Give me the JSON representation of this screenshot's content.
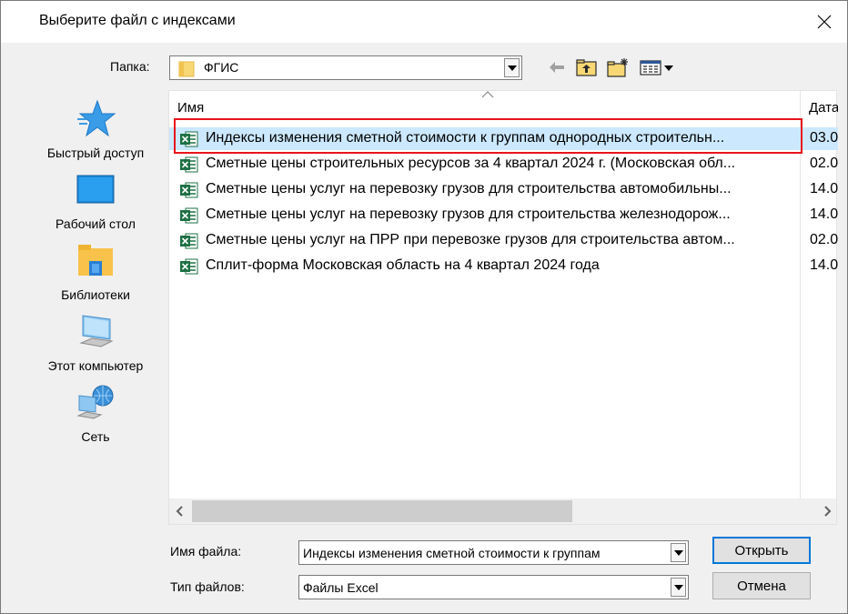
{
  "dialog": {
    "title": "Выберите файл с индексами"
  },
  "folder": {
    "label": "Папка:",
    "current": "ФГИС"
  },
  "places": [
    {
      "label": "Быстрый доступ",
      "icon": "quick-access-star-icon"
    },
    {
      "label": "Рабочий стол",
      "icon": "desktop-icon"
    },
    {
      "label": "Библиотеки",
      "icon": "libraries-icon"
    },
    {
      "label": "Этот компьютер",
      "icon": "this-pc-icon"
    },
    {
      "label": "Сеть",
      "icon": "network-icon"
    }
  ],
  "filelist": {
    "columns": {
      "name": "Имя",
      "date": "Дата"
    },
    "rows": [
      {
        "name": "Индексы изменения сметной стоимости к группам однородных строительн...",
        "date": "03.0",
        "selected": true
      },
      {
        "name": "Сметные цены строительных ресурсов за 4 квартал 2024 г. (Московская обл...",
        "date": "02.0"
      },
      {
        "name": "Сметные цены услуг на перевозку грузов для строительства автомобильны...",
        "date": "14.0"
      },
      {
        "name": "Сметные цены услуг на перевозку грузов для строительства железнодорож...",
        "date": "14.0"
      },
      {
        "name": "Сметные цены услуг на ПРР при перевозке грузов для строительства автом...",
        "date": "02.0"
      },
      {
        "name": "Сплит-форма Московская область на 4 квартал 2024 года",
        "date": "14.0"
      }
    ]
  },
  "filename": {
    "label": "Имя файла:",
    "value": "Индексы изменения сметной стоимости к группам"
  },
  "filetype": {
    "label": "Тип файлов:",
    "value": "Файлы Excel"
  },
  "buttons": {
    "open": "Открыть",
    "cancel": "Отмена"
  },
  "colors": {
    "selection": "#cce8ff",
    "highlight": "#e8141c",
    "excel_green": "#1d7044",
    "folder_yellow": "#f8d775"
  }
}
